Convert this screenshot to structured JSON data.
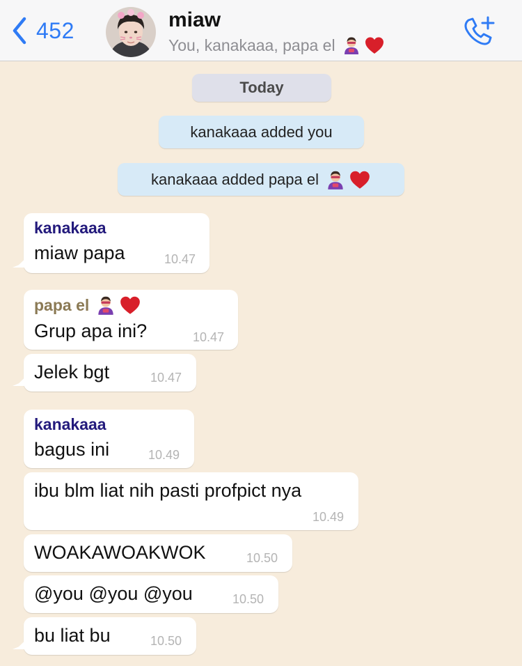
{
  "header": {
    "back_count": "452",
    "title": "miaw",
    "subtitle": "You, kanakaaa, papa el",
    "subtitle_emoji": [
      "superhero-emoji",
      "red-heart-emoji"
    ]
  },
  "chat": {
    "date_separator": "Today",
    "system_messages": [
      "kanakaaa added you",
      "kanakaaa added papa el"
    ],
    "messages": [
      {
        "sender": "kanakaaa",
        "text": "miaw papa",
        "time": "10.47"
      },
      {
        "sender": "papa el",
        "text": "Grup apa ini?",
        "time": "10.47"
      },
      {
        "sender": "",
        "text": "Jelek bgt",
        "time": "10.47"
      },
      {
        "sender": "kanakaaa",
        "text": "bagus ini",
        "time": "10.49"
      },
      {
        "sender": "",
        "text": "ibu blm liat nih pasti profpict nya",
        "time": "10.49"
      },
      {
        "sender": "",
        "text": "WOAKAWOAKWOK",
        "time": "10.50"
      },
      {
        "sender": "",
        "text": "@you @you @you",
        "time": "10.50"
      },
      {
        "sender": "",
        "text": "bu liat bu",
        "time": "10.50"
      }
    ]
  },
  "colors": {
    "accent": "#2f7bf5",
    "background": "#f7ecdc",
    "sender_kanakaaa": "#231a7c",
    "sender_papa_el": "#8b7a55",
    "system_bubble": "#d7eaf7"
  }
}
